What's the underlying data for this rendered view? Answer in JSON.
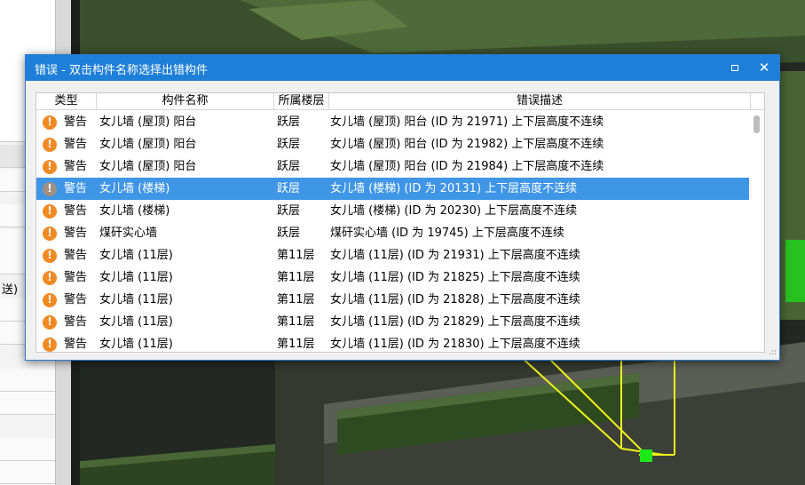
{
  "window": {
    "title": "错误 - 双击构件名称选择出错构件",
    "maximize_icon": "maximize-icon",
    "close_glyph": "✕"
  },
  "background": {
    "left_panel_text": "送)"
  },
  "columns": [
    "类型",
    "构件名称",
    "所属楼层",
    "错误描述"
  ],
  "rows": [
    {
      "type": "警告",
      "name": "女儿墙 (屋顶) 阳台",
      "floor": "跃层",
      "desc": "女儿墙 (屋顶) 阳台 (ID 为 21971) 上下层高度不连续",
      "selected": false
    },
    {
      "type": "警告",
      "name": "女儿墙 (屋顶) 阳台",
      "floor": "跃层",
      "desc": "女儿墙 (屋顶) 阳台 (ID 为 21982) 上下层高度不连续",
      "selected": false
    },
    {
      "type": "警告",
      "name": "女儿墙 (屋顶) 阳台",
      "floor": "跃层",
      "desc": "女儿墙 (屋顶) 阳台 (ID 为 21984) 上下层高度不连续",
      "selected": false
    },
    {
      "type": "警告",
      "name": "女儿墙 (楼梯)",
      "floor": "跃层",
      "desc": "女儿墙 (楼梯)  (ID 为 20131) 上下层高度不连续",
      "selected": true
    },
    {
      "type": "警告",
      "name": "女儿墙 (楼梯)",
      "floor": "跃层",
      "desc": "女儿墙 (楼梯)  (ID 为 20230) 上下层高度不连续",
      "selected": false
    },
    {
      "type": "警告",
      "name": "煤矸实心墙",
      "floor": "跃层",
      "desc": "煤矸实心墙 (ID 为 19745) 上下层高度不连续",
      "selected": false
    },
    {
      "type": "警告",
      "name": "女儿墙 (11层)",
      "floor": "第11层",
      "desc": "女儿墙 (11层)  (ID 为 21931) 上下层高度不连续",
      "selected": false
    },
    {
      "type": "警告",
      "name": "女儿墙 (11层)",
      "floor": "第11层",
      "desc": "女儿墙 (11层)  (ID 为 21825) 上下层高度不连续",
      "selected": false
    },
    {
      "type": "警告",
      "name": "女儿墙 (11层)",
      "floor": "第11层",
      "desc": "女儿墙 (11层)  (ID 为 21828) 上下层高度不连续",
      "selected": false
    },
    {
      "type": "警告",
      "name": "女儿墙 (11层)",
      "floor": "第11层",
      "desc": "女儿墙 (11层)  (ID 为 21829) 上下层高度不连续",
      "selected": false
    },
    {
      "type": "警告",
      "name": "女儿墙 (11层)",
      "floor": "第11层",
      "desc": "女儿墙 (11层)  (ID 为 21830) 上下层高度不连续",
      "selected": false
    }
  ],
  "colors": {
    "titlebar": "#1e7fd8",
    "selection": "#3f95e6",
    "warning_icon": "#f08a24",
    "scene_green": "#3d5a2a",
    "highlight_green": "#2fc82a",
    "guide_yellow": "#f2f21a"
  }
}
